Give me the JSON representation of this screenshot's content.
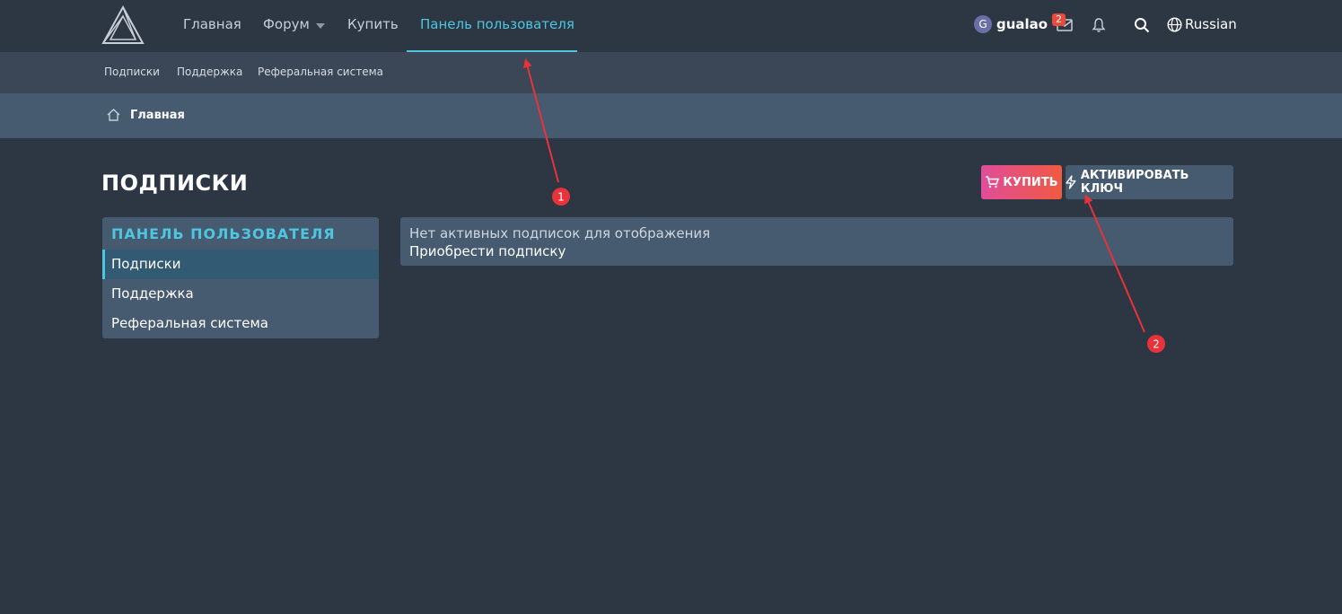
{
  "header": {
    "nav": [
      {
        "label": "Главная"
      },
      {
        "label": "Форум"
      },
      {
        "label": "Купить"
      },
      {
        "label": "Панель пользователя"
      }
    ],
    "user": {
      "avatar_letter": "G",
      "name": "gualao"
    },
    "mail_badge": "2",
    "language": "Russian"
  },
  "subnav": [
    {
      "label": "Подписки"
    },
    {
      "label": "Поддержка"
    },
    {
      "label": "Реферальная система"
    }
  ],
  "breadcrumb": {
    "label": "Главная"
  },
  "page": {
    "title": "ПОДПИСКИ",
    "buy_button": "КУПИТЬ",
    "activate_button": "АКТИВИРОВАТЬ КЛЮЧ"
  },
  "sidebar": {
    "title": "ПАНЕЛЬ ПОЛЬЗОВАТЕЛЯ",
    "items": [
      {
        "label": "Подписки"
      },
      {
        "label": "Поддержка"
      },
      {
        "label": "Реферальная система"
      }
    ]
  },
  "content": {
    "message": "Нет активных подписок для отображения",
    "link": "Приобрести подписку"
  },
  "annotations": [
    {
      "label": "1"
    },
    {
      "label": "2"
    }
  ],
  "colors": {
    "background": "#2d3643",
    "accent": "#4ec6e0",
    "panel": "#465a70",
    "annotation": "#e8333a"
  }
}
